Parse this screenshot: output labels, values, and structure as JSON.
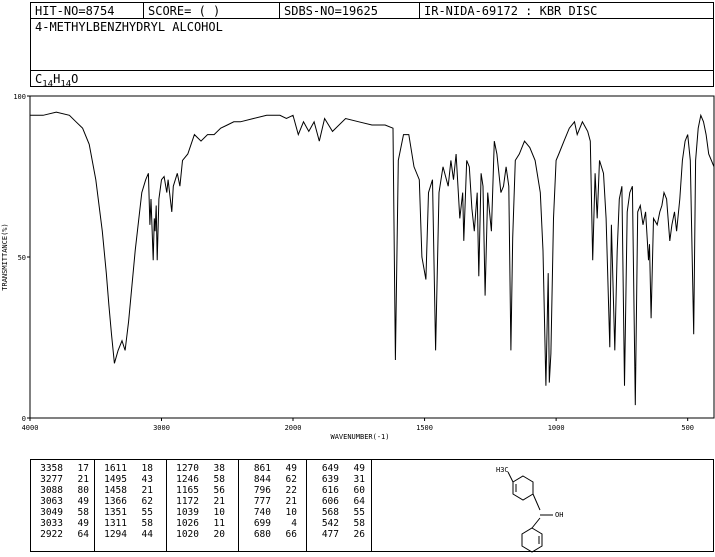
{
  "header": {
    "hit_no": "HIT-NO=8754",
    "score": "SCORE=  (   )",
    "sdbs_no": "SDBS-NO=19625",
    "ir_code": "IR-NIDA-69172 : KBR DISC"
  },
  "compound": {
    "name": "4-METHYLBENZHYDRYL ALCOHOL",
    "formula_parts": [
      "C",
      "14",
      "H",
      "14",
      "O"
    ]
  },
  "chart_data": {
    "type": "line",
    "title": "",
    "xlabel": "WAVENUMBER(-1)",
    "ylabel": "TRANSMITTANCE(%)",
    "xlim": [
      4000,
      400
    ],
    "ylim": [
      0,
      100
    ],
    "x_ticks": [
      4000,
      3000,
      2000,
      1500,
      1000,
      500
    ],
    "y_ticks": [
      0,
      50,
      100
    ],
    "grid": false,
    "legend": "none",
    "series": [
      {
        "points": [
          [
            4000,
            94
          ],
          [
            3900,
            94
          ],
          [
            3800,
            95
          ],
          [
            3700,
            94
          ],
          [
            3650,
            92
          ],
          [
            3600,
            90
          ],
          [
            3550,
            85
          ],
          [
            3500,
            74
          ],
          [
            3450,
            58
          ],
          [
            3420,
            45
          ],
          [
            3400,
            35
          ],
          [
            3380,
            26
          ],
          [
            3358,
            17
          ],
          [
            3330,
            21
          ],
          [
            3300,
            24
          ],
          [
            3277,
            21
          ],
          [
            3250,
            30
          ],
          [
            3200,
            52
          ],
          [
            3150,
            70
          ],
          [
            3120,
            74
          ],
          [
            3100,
            76
          ],
          [
            3088,
            60
          ],
          [
            3080,
            68
          ],
          [
            3063,
            49
          ],
          [
            3055,
            62
          ],
          [
            3049,
            58
          ],
          [
            3040,
            66
          ],
          [
            3033,
            49
          ],
          [
            3020,
            68
          ],
          [
            3000,
            74
          ],
          [
            2980,
            75
          ],
          [
            2960,
            70
          ],
          [
            2950,
            74
          ],
          [
            2922,
            64
          ],
          [
            2910,
            72
          ],
          [
            2880,
            76
          ],
          [
            2860,
            72
          ],
          [
            2840,
            80
          ],
          [
            2800,
            82
          ],
          [
            2750,
            88
          ],
          [
            2700,
            86
          ],
          [
            2650,
            88
          ],
          [
            2600,
            88
          ],
          [
            2550,
            90
          ],
          [
            2500,
            91
          ],
          [
            2450,
            92
          ],
          [
            2400,
            92
          ],
          [
            2300,
            93
          ],
          [
            2200,
            94
          ],
          [
            2100,
            94
          ],
          [
            2050,
            93
          ],
          [
            2000,
            94
          ],
          [
            1980,
            88
          ],
          [
            1960,
            92
          ],
          [
            1940,
            89
          ],
          [
            1920,
            92
          ],
          [
            1900,
            86
          ],
          [
            1880,
            93
          ],
          [
            1850,
            89
          ],
          [
            1800,
            93
          ],
          [
            1750,
            92
          ],
          [
            1700,
            91
          ],
          [
            1650,
            91
          ],
          [
            1620,
            90
          ],
          [
            1611,
            18
          ],
          [
            1600,
            80
          ],
          [
            1580,
            88
          ],
          [
            1560,
            88
          ],
          [
            1540,
            78
          ],
          [
            1520,
            74
          ],
          [
            1510,
            50
          ],
          [
            1495,
            43
          ],
          [
            1485,
            70
          ],
          [
            1470,
            74
          ],
          [
            1458,
            21
          ],
          [
            1445,
            70
          ],
          [
            1430,
            78
          ],
          [
            1410,
            72
          ],
          [
            1400,
            80
          ],
          [
            1390,
            74
          ],
          [
            1380,
            82
          ],
          [
            1366,
            62
          ],
          [
            1355,
            70
          ],
          [
            1351,
            55
          ],
          [
            1340,
            80
          ],
          [
            1330,
            78
          ],
          [
            1320,
            65
          ],
          [
            1311,
            58
          ],
          [
            1300,
            70
          ],
          [
            1294,
            44
          ],
          [
            1285,
            76
          ],
          [
            1278,
            72
          ],
          [
            1270,
            38
          ],
          [
            1260,
            70
          ],
          [
            1246,
            58
          ],
          [
            1235,
            86
          ],
          [
            1225,
            82
          ],
          [
            1210,
            70
          ],
          [
            1200,
            72
          ],
          [
            1190,
            78
          ],
          [
            1180,
            72
          ],
          [
            1172,
            21
          ],
          [
            1165,
            56
          ],
          [
            1155,
            80
          ],
          [
            1140,
            82
          ],
          [
            1120,
            86
          ],
          [
            1100,
            84
          ],
          [
            1080,
            80
          ],
          [
            1060,
            70
          ],
          [
            1050,
            52
          ],
          [
            1039,
            10
          ],
          [
            1030,
            45
          ],
          [
            1026,
            11
          ],
          [
            1020,
            20
          ],
          [
            1010,
            62
          ],
          [
            1000,
            80
          ],
          [
            990,
            82
          ],
          [
            970,
            86
          ],
          [
            950,
            90
          ],
          [
            930,
            92
          ],
          [
            920,
            88
          ],
          [
            900,
            92
          ],
          [
            880,
            89
          ],
          [
            870,
            86
          ],
          [
            861,
            49
          ],
          [
            852,
            76
          ],
          [
            844,
            62
          ],
          [
            835,
            80
          ],
          [
            820,
            76
          ],
          [
            810,
            62
          ],
          [
            796,
            22
          ],
          [
            790,
            60
          ],
          [
            777,
            21
          ],
          [
            768,
            52
          ],
          [
            760,
            68
          ],
          [
            750,
            72
          ],
          [
            740,
            10
          ],
          [
            730,
            64
          ],
          [
            720,
            70
          ],
          [
            710,
            72
          ],
          [
            699,
            4
          ],
          [
            690,
            64
          ],
          [
            680,
            66
          ],
          [
            670,
            60
          ],
          [
            660,
            64
          ],
          [
            649,
            49
          ],
          [
            645,
            54
          ],
          [
            639,
            31
          ],
          [
            630,
            62
          ],
          [
            616,
            60
          ],
          [
            606,
            64
          ],
          [
            598,
            66
          ],
          [
            590,
            70
          ],
          [
            580,
            68
          ],
          [
            568,
            55
          ],
          [
            560,
            60
          ],
          [
            550,
            64
          ],
          [
            542,
            58
          ],
          [
            530,
            68
          ],
          [
            520,
            80
          ],
          [
            510,
            86
          ],
          [
            500,
            88
          ],
          [
            490,
            80
          ],
          [
            477,
            26
          ],
          [
            470,
            80
          ],
          [
            460,
            90
          ],
          [
            450,
            94
          ],
          [
            440,
            92
          ],
          [
            430,
            88
          ],
          [
            420,
            82
          ],
          [
            410,
            80
          ],
          [
            400,
            78
          ]
        ]
      }
    ]
  },
  "peak_table": [
    [
      [
        3358,
        17
      ],
      [
        3277,
        21
      ],
      [
        3088,
        80
      ],
      [
        3063,
        49
      ],
      [
        3049,
        58
      ],
      [
        3033,
        49
      ],
      [
        2922,
        64
      ]
    ],
    [
      [
        1611,
        18
      ],
      [
        1495,
        43
      ],
      [
        1458,
        21
      ],
      [
        1366,
        62
      ],
      [
        1351,
        55
      ],
      [
        1311,
        58
      ],
      [
        1294,
        44
      ]
    ],
    [
      [
        1270,
        38
      ],
      [
        1246,
        58
      ],
      [
        1165,
        56
      ],
      [
        1172,
        21
      ],
      [
        1039,
        10
      ],
      [
        1026,
        11
      ],
      [
        1020,
        20
      ]
    ],
    [
      [
        861,
        49
      ],
      [
        844,
        62
      ],
      [
        796,
        22
      ],
      [
        777,
        21
      ],
      [
        740,
        10
      ],
      [
        699,
        4
      ],
      [
        680,
        66
      ]
    ],
    [
      [
        649,
        49
      ],
      [
        639,
        31
      ],
      [
        616,
        60
      ],
      [
        606,
        64
      ],
      [
        568,
        55
      ],
      [
        542,
        58
      ],
      [
        477,
        26
      ]
    ]
  ],
  "structure": {
    "methyl_label": "H3C",
    "hydroxyl_label": "OH"
  }
}
